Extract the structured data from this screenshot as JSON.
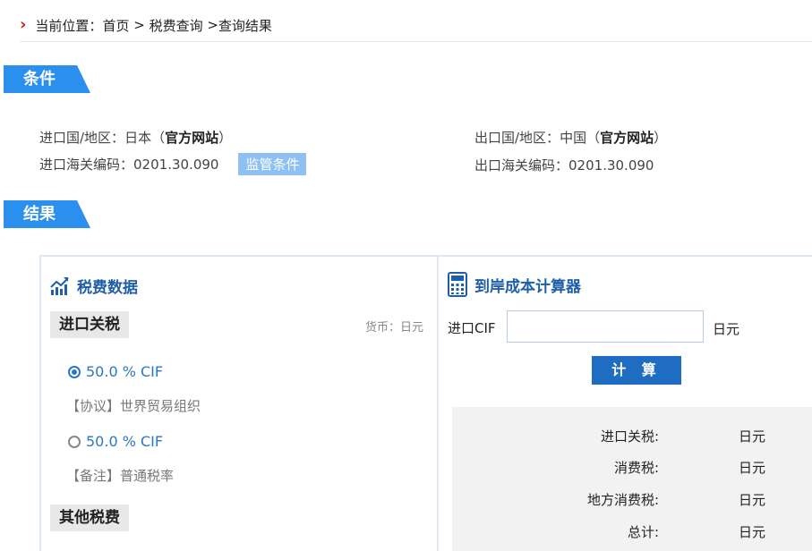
{
  "breadcrumb": {
    "chevron": "›",
    "prefix": "当前位置：",
    "home": "首页",
    "sep1": " > ",
    "query": "税费查询",
    "sep2": " >",
    "current": "查询结果"
  },
  "conditions": {
    "tag": "条件",
    "import_region_label": "进口国/地区：",
    "import_region_value": "日本",
    "official_site": "官方网站",
    "import_hs_label": "进口海关编码：",
    "import_hs_value": "0201.30.090",
    "regulatory_button": "监管条件",
    "export_region_label": "出口国/地区：",
    "export_region_value": "中国",
    "export_hs_label": "出口海关编码：",
    "export_hs_value": "0201.30.090",
    "paren_open": "（",
    "paren_close": "）"
  },
  "results": {
    "tag": "结果",
    "tax_data_title": "税费数据",
    "import_duty_label": "进口关税",
    "currency_label": "货币：日元",
    "rates": [
      {
        "rate": "50.0 % CIF",
        "note": "【协议】世界贸易组织",
        "selected": true
      },
      {
        "rate": "50.0 % CIF",
        "note": "【备注】普通税率",
        "selected": false
      }
    ],
    "other_fees_label": "其他税费",
    "calculator_title": "到岸成本计算器",
    "cif_label": "进口CIF",
    "cif_value": "",
    "cif_unit": "日元",
    "calc_button": "计 算",
    "breakdown": [
      {
        "label": "进口关税:",
        "unit": "日元"
      },
      {
        "label": "消费税:",
        "unit": "日元"
      },
      {
        "label": "地方消费税:",
        "unit": "日元"
      },
      {
        "label": "总计:",
        "unit": "日元"
      }
    ]
  },
  "colors": {
    "accent": "#2b8fee",
    "title_blue": "#1f5fa8",
    "button_blue": "#1f6cc3",
    "chevron_red": "#c62828"
  }
}
